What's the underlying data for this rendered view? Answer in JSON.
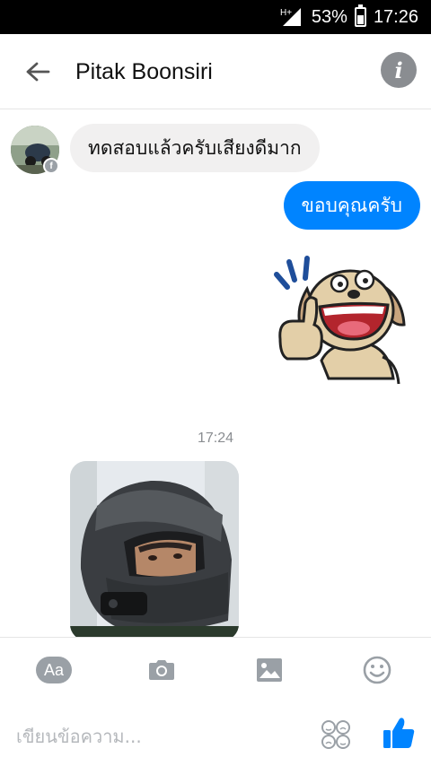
{
  "status_bar": {
    "network": "H+",
    "battery_percent": "53%",
    "battery_level": 0.53,
    "time": "17:26"
  },
  "header": {
    "title": "Pitak Boonsiri",
    "back_icon": "arrow-left-icon",
    "info_icon": "info-icon"
  },
  "messages": {
    "incoming_text": "ทดสอบแล้วครับเสียงดีมาก",
    "outgoing_text": "ขอบคุณครับ",
    "sticker": "thumbs-up-dog-sticker",
    "timestamp": "17:24",
    "photo": "helmet-selfie-photo"
  },
  "composer": {
    "aa_label": "Aa",
    "placeholder": "เขียนข้อความ...",
    "icons": [
      "camera-icon",
      "image-icon",
      "emoji-icon",
      "reactions-icon",
      "like-icon"
    ]
  },
  "colors": {
    "accent": "#0084ff",
    "incoming_bubble": "#f1f0f0",
    "icon_gray": "#9aa0a6"
  }
}
